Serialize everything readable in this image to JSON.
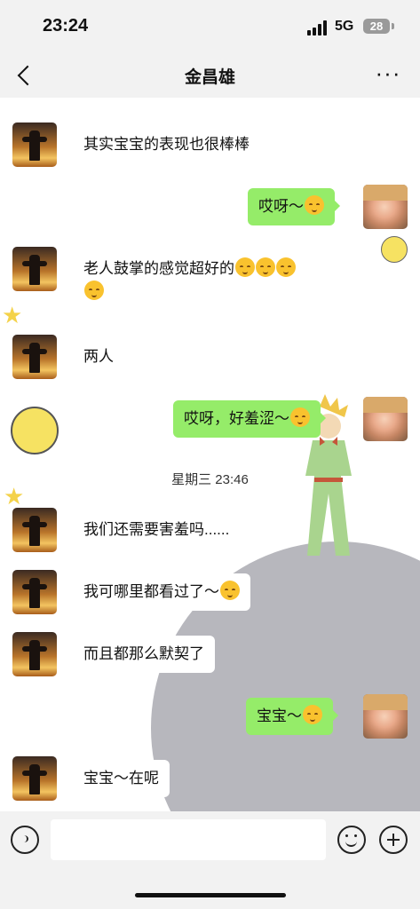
{
  "status": {
    "time": "23:24",
    "network": "5G",
    "battery": "28"
  },
  "header": {
    "title": "金昌雄",
    "more": "···"
  },
  "messages": [
    {
      "side": "left",
      "text": "其实宝宝的表现也很棒棒"
    },
    {
      "side": "right",
      "text": "哎呀～"
    },
    {
      "side": "left",
      "text": "老人鼓掌的感觉超好的"
    },
    {
      "side": "left",
      "text": "两人"
    },
    {
      "side": "right",
      "text": "哎呀，好羞涩～"
    },
    {
      "side": "left",
      "text": "我们还需要害羞吗......"
    },
    {
      "side": "left",
      "text": "我可哪里都看过了～"
    },
    {
      "side": "left",
      "text": "而且都那么默契了"
    },
    {
      "side": "right",
      "text": "宝宝～"
    },
    {
      "side": "left",
      "text": "宝宝～在呢"
    }
  ],
  "timestamp": "星期三 23:46",
  "colors": {
    "bubble_right": "#95ec69",
    "bubble_left": "#ffffff",
    "background": "#f2f2f2"
  }
}
